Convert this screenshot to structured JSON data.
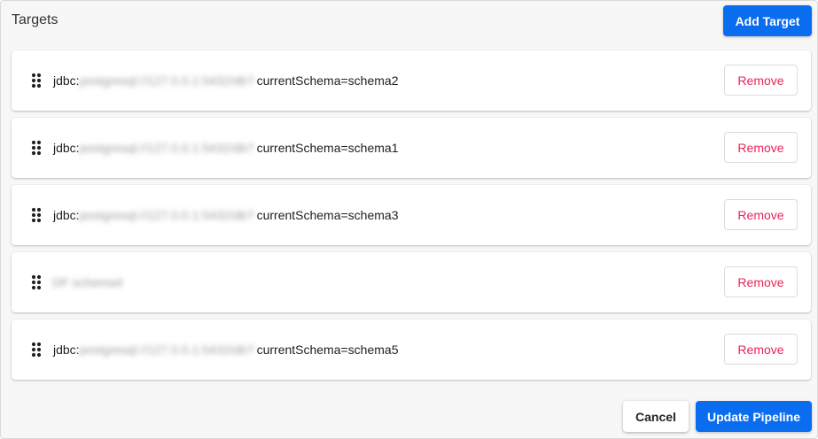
{
  "header": {
    "title": "Targets",
    "add_target_label": "Add Target"
  },
  "targets": [
    {
      "prefix": "jdbc:",
      "host_redacted": "postgresql://127.0.0.1:5432/db?",
      "suffix": "currentSchema=schema2",
      "remove_label": "Remove"
    },
    {
      "prefix": "jdbc:",
      "host_redacted": "postgresql://127.0.0.1:5432/db?",
      "suffix": "currentSchema=schema1",
      "remove_label": "Remove"
    },
    {
      "prefix": "jdbc:",
      "host_redacted": "postgresql://127.0.0.1:5432/db?",
      "suffix": "currentSchema=schema3",
      "remove_label": "Remove"
    },
    {
      "prefix": "",
      "host_redacted": "",
      "name_redacted": "DF schema4",
      "suffix": "",
      "remove_label": "Remove"
    },
    {
      "prefix": "jdbc:",
      "host_redacted": "postgresql://127.0.0.1:5432/db?",
      "suffix": "currentSchema=schema5",
      "remove_label": "Remove"
    }
  ],
  "footer": {
    "cancel_label": "Cancel",
    "update_label": "Update Pipeline"
  },
  "icons": {
    "drag_handle": "drag-handle-icon"
  },
  "colors": {
    "primary": "#0a6df0",
    "danger_text": "#e8245b",
    "background": "#f7f7f7"
  }
}
